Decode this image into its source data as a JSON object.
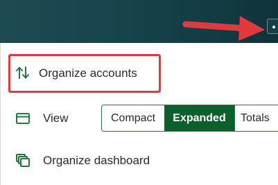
{
  "header": {
    "menu_trigger_icon": "more-dots-icon"
  },
  "annotation": {
    "arrow_color": "#e0393e",
    "highlight_color": "#e0393e"
  },
  "menu": {
    "organize_accounts": {
      "label": "Organize accounts",
      "icon": "sort-arrows-icon"
    },
    "view": {
      "label": "View",
      "icon": "window-icon",
      "options": [
        "Compact",
        "Expanded",
        "Totals"
      ],
      "selected": "Expanded"
    },
    "organize_dashboard": {
      "label": "Organize dashboard",
      "icon": "stacked-windows-icon"
    }
  },
  "colors": {
    "header_bg": "#17454d",
    "accent_green": "#0d5f2c"
  }
}
